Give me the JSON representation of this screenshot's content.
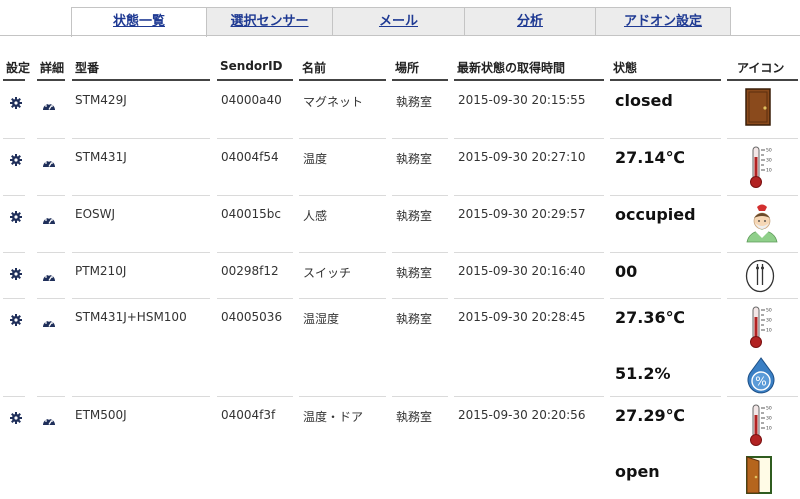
{
  "tabs": [
    "状態一覧",
    "選択センサー",
    "メール",
    "分析",
    "アドオン設定"
  ],
  "columns": {
    "settings": "設定",
    "detail": "詳細",
    "model": "型番",
    "sensor_id": "SendorID",
    "name": "名前",
    "location": "場所",
    "time": "最新状態の取得時間",
    "state": "状態",
    "icon": "アイコン"
  },
  "rows": [
    {
      "model": "STM429J",
      "sensor_id": "04000a40",
      "name": "マグネット",
      "location": "執務室",
      "time": "2015-09-30 20:15:55",
      "state": "closed",
      "icon": "closed-door-icon"
    },
    {
      "model": "STM431J",
      "sensor_id": "04004f54",
      "name": "温度",
      "location": "執務室",
      "time": "2015-09-30 20:27:10",
      "state": "27.14℃",
      "icon": "thermometer-icon"
    },
    {
      "model": "EOSWJ",
      "sensor_id": "040015bc",
      "name": "人感",
      "location": "執務室",
      "time": "2015-09-30 20:29:57",
      "state": "occupied",
      "icon": "person-icon"
    },
    {
      "model": "PTM210J",
      "sensor_id": "00298f12",
      "name": "スイッチ",
      "location": "執務室",
      "time": "2015-09-30 20:16:40",
      "state": "00",
      "icon": "switch-icon"
    },
    {
      "model": "STM431J+HSM100",
      "sensor_id": "04005036",
      "name": "温湿度",
      "location": "執務室",
      "time": "2015-09-30 20:28:45",
      "state": "27.36℃",
      "icon": "thermometer-icon",
      "state2": "51.2%",
      "icon2": "humidity-icon"
    },
    {
      "model": "ETM500J",
      "sensor_id": "04004f3f",
      "name": "温度・ドア",
      "location": "執務室",
      "time": "2015-09-30 20:20:56",
      "state": "27.29℃",
      "icon": "thermometer-icon",
      "state2": "open",
      "icon2": "open-door-icon"
    }
  ]
}
